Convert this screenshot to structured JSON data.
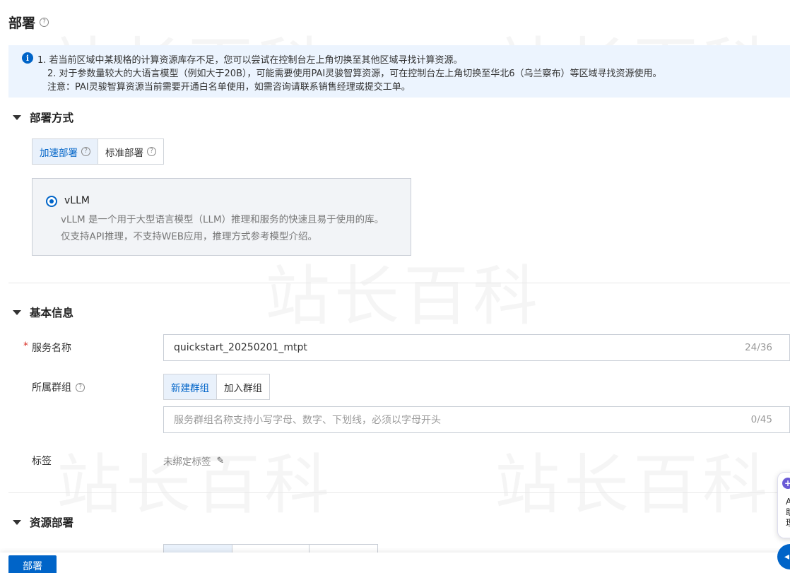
{
  "page": {
    "title": "部署"
  },
  "watermark": {
    "text": "站长百科"
  },
  "notice": {
    "lines": [
      "1. 若当前区域中某规格的计算资源库存不足，您可以尝试在控制台左上角切换至其他区域寻找计算资源。",
      "2. 对于参数量较大的大语言模型（例如大于20B），可能需要使用PAI灵骏智算资源，可在控制台左上角切换至华北6（乌兰察布）等区域寻找资源使用。",
      "注意：PAI灵骏智算资源当前需要开通白名单使用，如需咨询请联系销售经理或提交工单。"
    ]
  },
  "deploy_method": {
    "title": "部署方式",
    "options": [
      "加速部署",
      "标准部署"
    ],
    "selected": "加速部署",
    "engine": {
      "name": "vLLM",
      "desc_line1": "vLLM 是一个用于大型语言模型（LLM）推理和服务的快速且易于使用的库。",
      "desc_line2": "仅支持API推理，不支持WEB应用，推理方式参考模型介绍。"
    }
  },
  "basic_info": {
    "title": "基本信息",
    "service_name": {
      "label": "服务名称",
      "value": "quickstart_20250201_mtpt",
      "count": "24/36"
    },
    "group": {
      "label": "所属群组",
      "options": [
        "新建群组",
        "加入群组"
      ],
      "selected": "新建群组",
      "placeholder": "服务群组名称支持小写字母、数字、下划线，必须以字母开头",
      "count": "0/45"
    },
    "tags": {
      "label": "标签",
      "value": "未绑定标签"
    }
  },
  "resource_deploy": {
    "title": "资源部署"
  },
  "footer": {
    "deploy_label": "部署"
  },
  "float_widget": {
    "lines": [
      "A",
      "助",
      "理"
    ]
  },
  "colors": {
    "primary": "#0064c8",
    "notice_bg": "#ecf4fe",
    "required": "#d93026"
  }
}
